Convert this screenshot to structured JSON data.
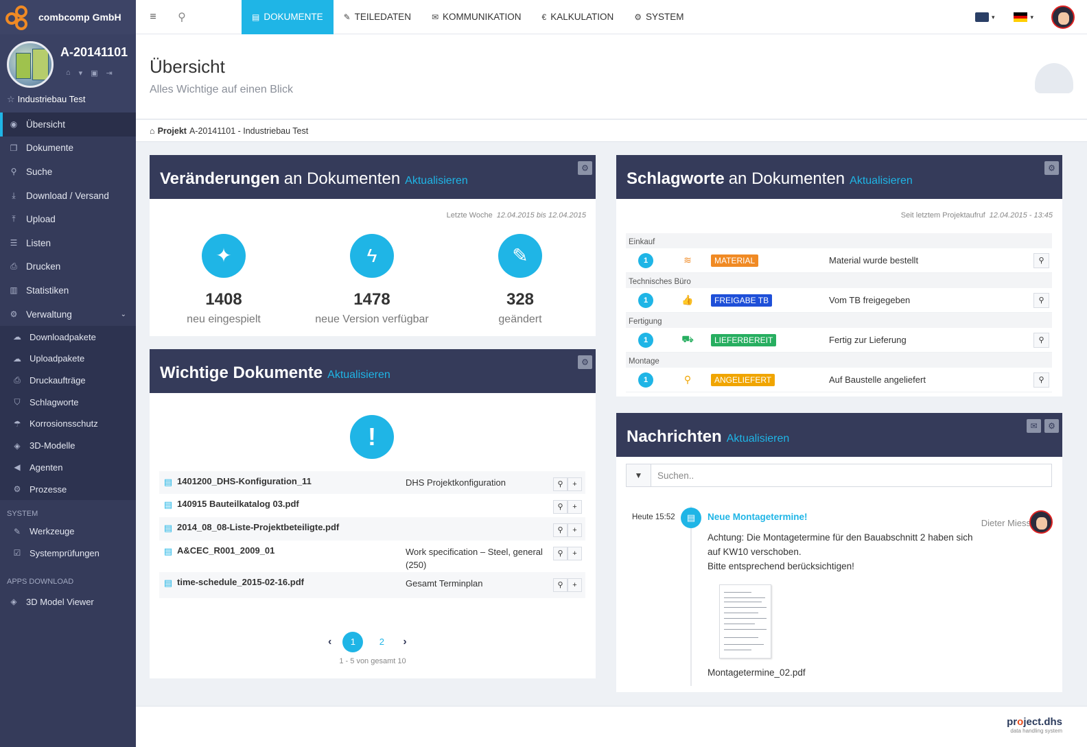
{
  "brand": {
    "company": "combcomp GmbH"
  },
  "project": {
    "id": "A-20141101",
    "name": "Industriebau Test"
  },
  "sidebar": {
    "items": [
      {
        "label": "Übersicht",
        "icon": "dashboard-icon",
        "glyph": "◉",
        "active": true
      },
      {
        "label": "Dokumente",
        "icon": "documents-icon",
        "glyph": "❐"
      },
      {
        "label": "Suche",
        "icon": "search-icon",
        "glyph": "⚲"
      },
      {
        "label": "Download / Versand",
        "icon": "download-icon",
        "glyph": "⤓"
      },
      {
        "label": "Upload",
        "icon": "upload-icon",
        "glyph": "⤒"
      },
      {
        "label": "Listen",
        "icon": "list-icon",
        "glyph": "☰"
      },
      {
        "label": "Drucken",
        "icon": "print-icon",
        "glyph": "⎙"
      },
      {
        "label": "Statistiken",
        "icon": "bar-chart-icon",
        "glyph": "▥"
      },
      {
        "label": "Verwaltung",
        "icon": "cogs-icon",
        "glyph": "⚙",
        "expanded": true
      }
    ],
    "subitems": [
      {
        "label": "Downloadpakete",
        "icon": "cloud-download-icon",
        "glyph": "☁"
      },
      {
        "label": "Uploadpakete",
        "icon": "cloud-upload-icon",
        "glyph": "☁"
      },
      {
        "label": "Druckaufträge",
        "icon": "print-icon",
        "glyph": "⎙"
      },
      {
        "label": "Schlagworte",
        "icon": "tags-icon",
        "glyph": "⛉"
      },
      {
        "label": "Korrosionsschutz",
        "icon": "umbrella-icon",
        "glyph": "☂"
      },
      {
        "label": "3D-Modelle",
        "icon": "cube-icon",
        "glyph": "◈"
      },
      {
        "label": "Agenten",
        "icon": "bullhorn-icon",
        "glyph": "◀"
      },
      {
        "label": "Prozesse",
        "icon": "cog-icon",
        "glyph": "⚙"
      }
    ],
    "system_label": "SYSTEM",
    "system_items": [
      {
        "label": "Werkzeuge",
        "icon": "wrench-icon",
        "glyph": "✎"
      },
      {
        "label": "Systemprüfungen",
        "icon": "check-square-icon",
        "glyph": "☑"
      }
    ],
    "apps_label": "APPS DOWNLOAD",
    "apps_items": [
      {
        "label": "3D Model Viewer",
        "icon": "cubes-icon",
        "glyph": "◈"
      }
    ]
  },
  "topbar": {
    "tabs": [
      {
        "label": "DOKUMENTE",
        "icon": "file-icon",
        "glyph": "▤",
        "active": true
      },
      {
        "label": "TEILEDATEN",
        "icon": "wrench-icon",
        "glyph": "✎"
      },
      {
        "label": "KOMMUNIKATION",
        "icon": "envelope-icon",
        "glyph": "✉"
      },
      {
        "label": "KALKULATION",
        "icon": "euro-icon",
        "glyph": "€"
      },
      {
        "label": "SYSTEM",
        "icon": "cogs-icon",
        "glyph": "⚙"
      }
    ],
    "flag_colors": [
      "#000000",
      "#dd0000",
      "#ffce00"
    ]
  },
  "page": {
    "title": "Übersicht",
    "subtitle": "Alles Wichtige auf einen Blick"
  },
  "breadcrumb": {
    "root": "Projekt",
    "path": "A-20141101 - Industriebau Test"
  },
  "changes": {
    "title_bold": "Veränderungen",
    "title_rest": "an Dokumenten",
    "refresh": "Aktualisieren",
    "period_label": "Letzte Woche",
    "period_value": "12.04.2015 bis 12.04.2015",
    "stats": [
      {
        "value": "1408",
        "label": "neu eingespielt",
        "icon": "magic-wand-icon",
        "glyph": "✦"
      },
      {
        "value": "1478",
        "label": "neue Version verfügbar",
        "icon": "bolt-icon",
        "glyph": "ϟ"
      },
      {
        "value": "328",
        "label": "geändert",
        "icon": "pencil-icon",
        "glyph": "✎"
      }
    ]
  },
  "important": {
    "title_bold": "Wichtige Dokumente",
    "refresh": "Aktualisieren",
    "docs": [
      {
        "name": "1401200_DHS-Konfiguration_11",
        "desc": "DHS Projektkonfiguration"
      },
      {
        "name": "140915 Bauteilkatalog 03.pdf",
        "desc": ""
      },
      {
        "name": "2014_08_08-Liste-Projektbeteiligte.pdf",
        "desc": ""
      },
      {
        "name": "A&CEC_R001_2009_01",
        "desc": "Work specification – Steel, general (250)"
      },
      {
        "name": "time-schedule_2015-02-16.pdf",
        "desc": "Gesamt Terminplan"
      }
    ],
    "pages": [
      "1",
      "2"
    ],
    "current_page": "1",
    "summary": "1 - 5 von gesamt 10"
  },
  "keywords": {
    "title_bold": "Schlagworte",
    "title_rest": "an Dokumenten",
    "refresh": "Aktualisieren",
    "period_label": "Seit letztem Projektaufruf",
    "period_value": "12.04.2015 - 13:45",
    "groups": [
      {
        "group": "Einkauf",
        "count": "1",
        "icon": "stack-overflow-icon",
        "glyph": "≋",
        "icon_color": "#f08a24",
        "badge": "MATERIAL",
        "badge_color": "#f08a24",
        "text": "Material wurde bestellt"
      },
      {
        "group": "Technisches Büro",
        "count": "1",
        "icon": "thumbs-up-icon",
        "glyph": "👍",
        "icon_color": "#1e4fd8",
        "badge": "FREIGABE TB",
        "badge_color": "#1e4fd8",
        "text": "Vom TB freigegeben"
      },
      {
        "group": "Fertigung",
        "count": "1",
        "icon": "truck-icon",
        "glyph": "⛟",
        "icon_color": "#27ae60",
        "badge": "LIEFERBEREIT",
        "badge_color": "#27ae60",
        "text": "Fertig zur Lieferung"
      },
      {
        "group": "Montage",
        "count": "1",
        "icon": "map-marker-icon",
        "glyph": "⚲",
        "icon_color": "#f0a500",
        "badge": "ANGELIEFERT",
        "badge_color": "#f0a500",
        "text": "Auf Baustelle angeliefert"
      }
    ]
  },
  "news": {
    "title_bold": "Nachrichten",
    "refresh": "Aktualisieren",
    "search_placeholder": "Suchen..",
    "messages": [
      {
        "time": "Heute 15:52",
        "title": "Neue Montagetermine!",
        "author": "Dieter Miess",
        "body_1": "Achtung: Die Montagetermine für den Bauabschnitt 2 haben sich auf KW10 verschoben.",
        "body_2": "Bitte entsprechend berücksichtigen!",
        "attachment": "Montagetermine_02.pdf"
      }
    ]
  },
  "footer": {
    "logo_pre": "pr",
    "logo_o": "o",
    "logo_post": "ject.dhs",
    "tagline": "data handling system"
  }
}
